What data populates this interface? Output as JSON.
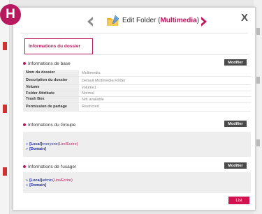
{
  "badge": "H",
  "header": {
    "title_prefix": "Edit Folder (",
    "title_folder": "Multimedia",
    "title_suffix": ")",
    "close": "X"
  },
  "tab": {
    "label": "Informations du dossier"
  },
  "base": {
    "title": "Informations de base",
    "modify": "Modifier",
    "rows": [
      {
        "key": "Nom du dossier",
        "value": "Multimedia"
      },
      {
        "key": "Description du dossier",
        "value": "Default Multimedia Folder"
      },
      {
        "key": "Volume",
        "value": "volume1"
      },
      {
        "key": "Folder Attribute",
        "value": "Normal"
      },
      {
        "key": "Trash Box",
        "value": "Not available"
      },
      {
        "key": "Permission de partage",
        "value": "Restricted"
      }
    ]
  },
  "group": {
    "title": "Informations du Groupe",
    "modify": "Modifier",
    "entries": [
      {
        "bullet": "»",
        "tag": "[Local]",
        "user": "everyone",
        "rw": "(Lire/Ecrire)"
      },
      {
        "bullet": "»",
        "tag": "[Domain]",
        "user": "",
        "rw": ""
      }
    ]
  },
  "user": {
    "title": "Informations de l'usager",
    "modify": "Modifier",
    "entries": [
      {
        "bullet": "»",
        "tag": "[Local]",
        "user": "admin",
        "rw": "(Lire/Ecrire)"
      },
      {
        "bullet": "»",
        "tag": "[Domain]",
        "user": "",
        "rw": ""
      }
    ]
  },
  "footer": {
    "list_label": "List"
  },
  "colors": {
    "accent": "#b8185d",
    "button_dark": "#4a4a4a",
    "list_button": "#d3114f",
    "link_blue": "#1d2d9c"
  },
  "icons": {
    "prev": "chevron-left-icon",
    "next": "chevron-right-icon",
    "folder": "folder-edit-icon",
    "close": "close-icon"
  }
}
